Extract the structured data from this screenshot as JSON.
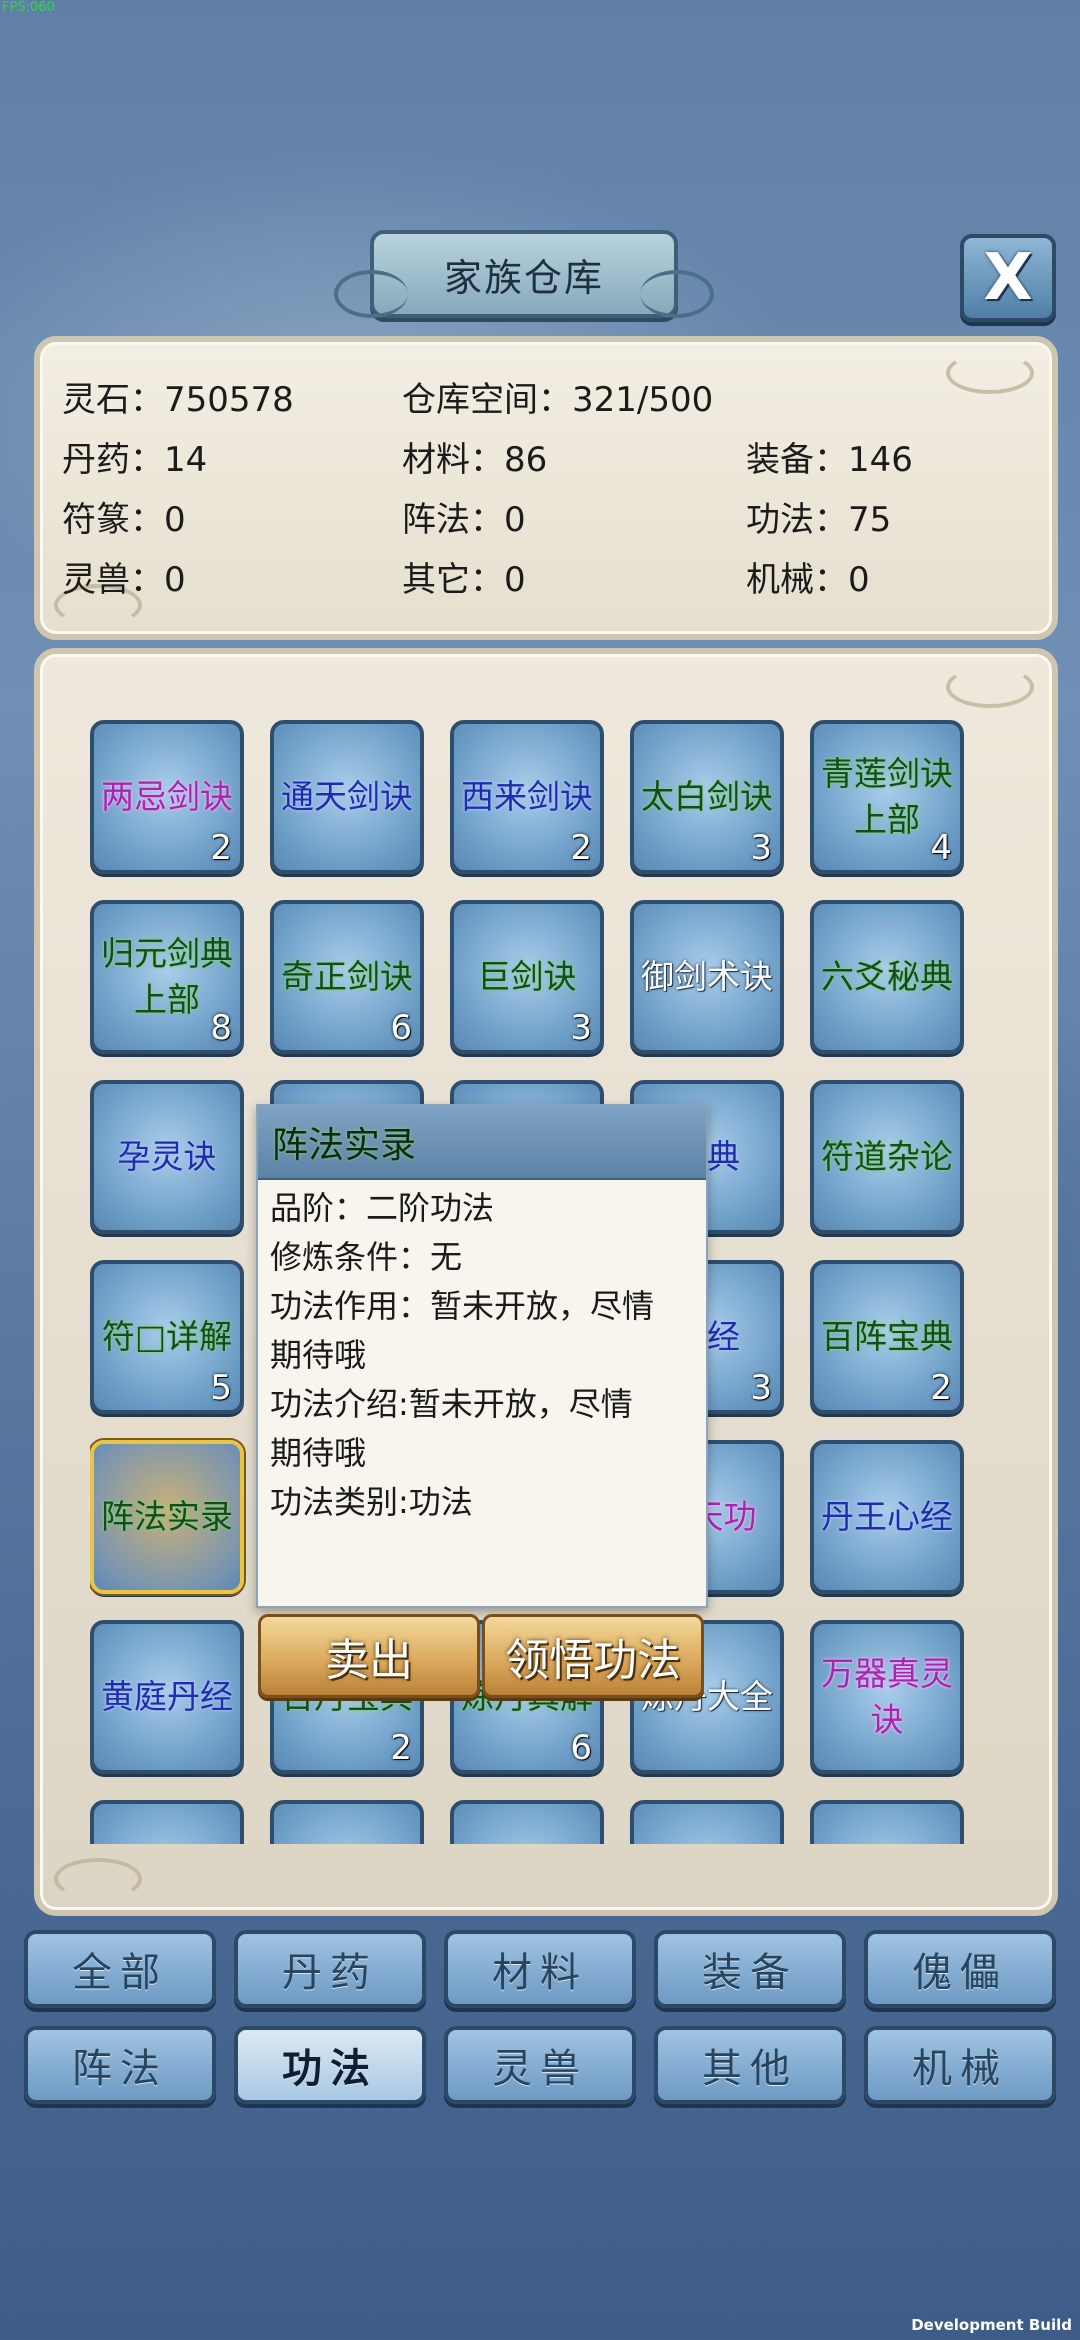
{
  "overlay": {
    "fps": "FPS:060",
    "build": "Development Build"
  },
  "header": {
    "title": "家族仓库",
    "close_label": "X"
  },
  "stats": {
    "lingshi": "灵石：750578",
    "space": "仓库空间：321/500",
    "danyao": "丹药：14",
    "cailiao": "材料：86",
    "zhuangbei": "装备：146",
    "fuzhuan": "符篆：0",
    "zhenfa": "阵法：0",
    "gongfa": "功法：75",
    "lingshou": "灵兽：0",
    "qita": "其它：0",
    "jixie": "机械：0"
  },
  "grid": [
    {
      "name": "两忌剑诀",
      "qty": "2",
      "color": "p"
    },
    {
      "name": "通天剑诀",
      "qty": "",
      "color": "b"
    },
    {
      "name": "西来剑诀",
      "qty": "2",
      "color": "b"
    },
    {
      "name": "太白剑诀",
      "qty": "3",
      "color": "g"
    },
    {
      "name": "青莲剑诀上部",
      "qty": "4",
      "color": "g"
    },
    {
      "name": "归元剑典上部",
      "qty": "8",
      "color": "g"
    },
    {
      "name": "奇正剑诀",
      "qty": "6",
      "color": "g"
    },
    {
      "name": "巨剑诀",
      "qty": "3",
      "color": "g"
    },
    {
      "name": "御剑术诀",
      "qty": "",
      "color": "w"
    },
    {
      "name": "六爻秘典",
      "qty": "",
      "color": "g"
    },
    {
      "name": "孕灵诀",
      "qty": "",
      "color": "b"
    },
    {
      "name": "",
      "qty": "",
      "color": "g"
    },
    {
      "name": "",
      "qty": "",
      "color": "g"
    },
    {
      "name": "秘典",
      "qty": "",
      "color": "b"
    },
    {
      "name": "符道杂论",
      "qty": "",
      "color": "g"
    },
    {
      "name": "符□详解",
      "qty": "5",
      "color": "g"
    },
    {
      "name": "",
      "qty": "",
      "color": "g"
    },
    {
      "name": "",
      "qty": "",
      "color": "g"
    },
    {
      "name": "真经",
      "qty": "3",
      "color": "b"
    },
    {
      "name": "百阵宝典",
      "qty": "2",
      "color": "g"
    },
    {
      "name": "阵法实录",
      "qty": "",
      "color": "g"
    },
    {
      "name": "",
      "qty": "",
      "color": "g"
    },
    {
      "name": "",
      "qty": "",
      "color": "g"
    },
    {
      "name": "通天功",
      "qty": "",
      "color": "p"
    },
    {
      "name": "丹王心经",
      "qty": "",
      "color": "b"
    },
    {
      "name": "黄庭丹经",
      "qty": "",
      "color": "b"
    },
    {
      "name": "百丹宝典",
      "qty": "2",
      "color": "g"
    },
    {
      "name": "炼丹真解",
      "qty": "6",
      "color": "g"
    },
    {
      "name": "炼丹大全",
      "qty": "",
      "color": "w"
    },
    {
      "name": "万器真灵诀",
      "qty": "",
      "color": "p"
    }
  ],
  "tooltip": {
    "title": "阵法实录",
    "lines": [
      "品阶：二阶功法",
      "修炼条件：无",
      "功法作用：暂未开放，尽情",
      "期待哦",
      "功法介绍:暂未开放，尽情",
      "期待哦",
      "功法类别:功法"
    ],
    "sell_label": "卖出",
    "learn_label": "领悟功法"
  },
  "categories": [
    {
      "label": "全部",
      "active": false
    },
    {
      "label": "丹药",
      "active": false
    },
    {
      "label": "材料",
      "active": false
    },
    {
      "label": "装备",
      "active": false
    },
    {
      "label": "傀儡",
      "active": false
    },
    {
      "label": "阵法",
      "active": false
    },
    {
      "label": "功法",
      "active": true
    },
    {
      "label": "灵兽",
      "active": false
    },
    {
      "label": "其他",
      "active": false
    },
    {
      "label": "机械",
      "active": false
    }
  ]
}
